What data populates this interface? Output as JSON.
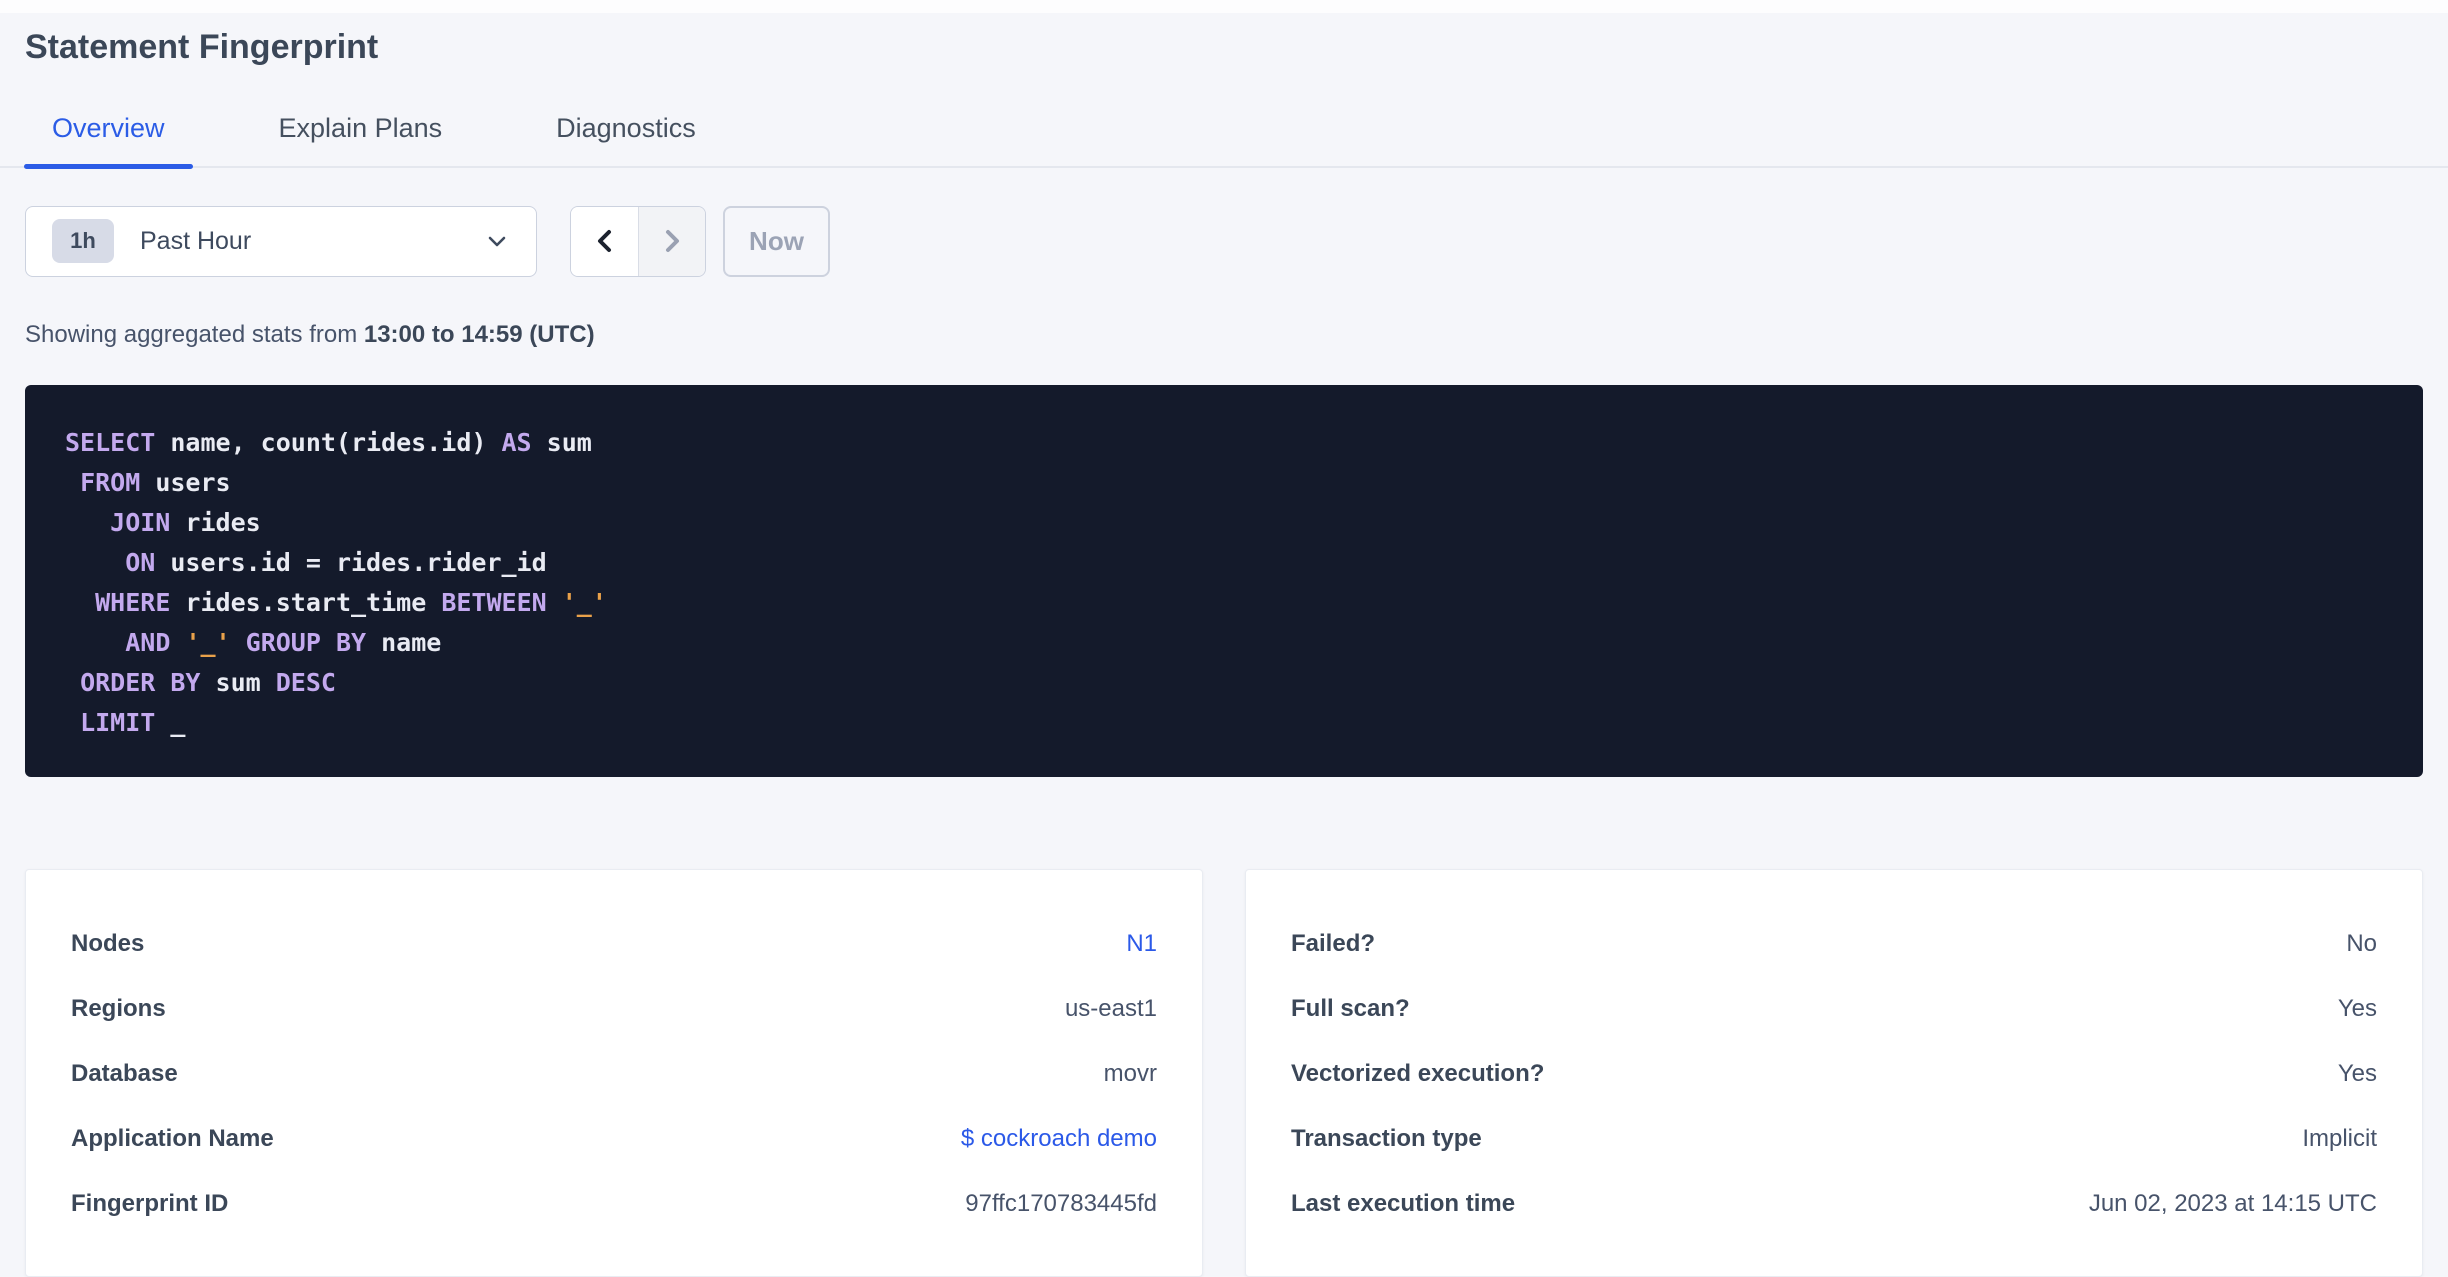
{
  "page": {
    "title": "Statement Fingerprint"
  },
  "colors": {
    "accent": "#2b5ce6",
    "link": "#2b59e8",
    "sql_bg": "#141a2b",
    "sql_keyword": "#c3a9ee",
    "sql_text": "#e9ebf3",
    "sql_string": "#e9a14a"
  },
  "tabs": [
    {
      "label": "Overview",
      "active": true
    },
    {
      "label": "Explain Plans",
      "active": false
    },
    {
      "label": "Diagnostics",
      "active": false
    }
  ],
  "time_controls": {
    "range_badge": "1h",
    "range_label": "Past Hour",
    "now_label": "Now"
  },
  "summary": {
    "prefix": "Showing aggregated stats from ",
    "bold_range": "13:00 to 14:59 (UTC)"
  },
  "sql": {
    "lines": [
      [
        {
          "k": "kw",
          "v": "SELECT"
        },
        {
          "k": "tx",
          "v": " name, count(rides.id) "
        },
        {
          "k": "kw",
          "v": "AS"
        },
        {
          "k": "tx",
          "v": " sum"
        }
      ],
      [
        {
          "k": "tx",
          "v": " "
        },
        {
          "k": "kw",
          "v": "FROM"
        },
        {
          "k": "tx",
          "v": " users"
        }
      ],
      [
        {
          "k": "tx",
          "v": "   "
        },
        {
          "k": "kw",
          "v": "JOIN"
        },
        {
          "k": "tx",
          "v": " rides"
        }
      ],
      [
        {
          "k": "tx",
          "v": "    "
        },
        {
          "k": "kw",
          "v": "ON"
        },
        {
          "k": "tx",
          "v": " users.id = rides.rider_id"
        }
      ],
      [
        {
          "k": "tx",
          "v": "  "
        },
        {
          "k": "kw",
          "v": "WHERE"
        },
        {
          "k": "tx",
          "v": " rides.start_time "
        },
        {
          "k": "kw",
          "v": "BETWEEN"
        },
        {
          "k": "tx",
          "v": " "
        },
        {
          "k": "str",
          "v": "'_'"
        }
      ],
      [
        {
          "k": "tx",
          "v": "    "
        },
        {
          "k": "kw",
          "v": "AND"
        },
        {
          "k": "tx",
          "v": " "
        },
        {
          "k": "str",
          "v": "'_'"
        },
        {
          "k": "tx",
          "v": " "
        },
        {
          "k": "kw",
          "v": "GROUP BY"
        },
        {
          "k": "tx",
          "v": " name"
        }
      ],
      [
        {
          "k": "tx",
          "v": " "
        },
        {
          "k": "kw",
          "v": "ORDER BY"
        },
        {
          "k": "tx",
          "v": " sum "
        },
        {
          "k": "kw",
          "v": "DESC"
        }
      ],
      [
        {
          "k": "tx",
          "v": " "
        },
        {
          "k": "kw",
          "v": "LIMIT"
        },
        {
          "k": "tx",
          "v": " _"
        }
      ]
    ]
  },
  "cards": [
    {
      "name": "statement-details",
      "rows": [
        {
          "label": "Nodes",
          "value": "N1",
          "link": true
        },
        {
          "label": "Regions",
          "value": "us-east1"
        },
        {
          "label": "Database",
          "value": "movr"
        },
        {
          "label": "Application Name",
          "value": "$ cockroach demo",
          "link": true
        },
        {
          "label": "Fingerprint ID",
          "value": "97ffc170783445fd"
        }
      ]
    },
    {
      "name": "execution-attributes",
      "rows": [
        {
          "label": "Failed?",
          "value": "No"
        },
        {
          "label": "Full scan?",
          "value": "Yes"
        },
        {
          "label": "Vectorized execution?",
          "value": "Yes"
        },
        {
          "label": "Transaction type",
          "value": "Implicit"
        },
        {
          "label": "Last execution time",
          "value": "Jun 02, 2023 at 14:15 UTC"
        }
      ]
    }
  ]
}
